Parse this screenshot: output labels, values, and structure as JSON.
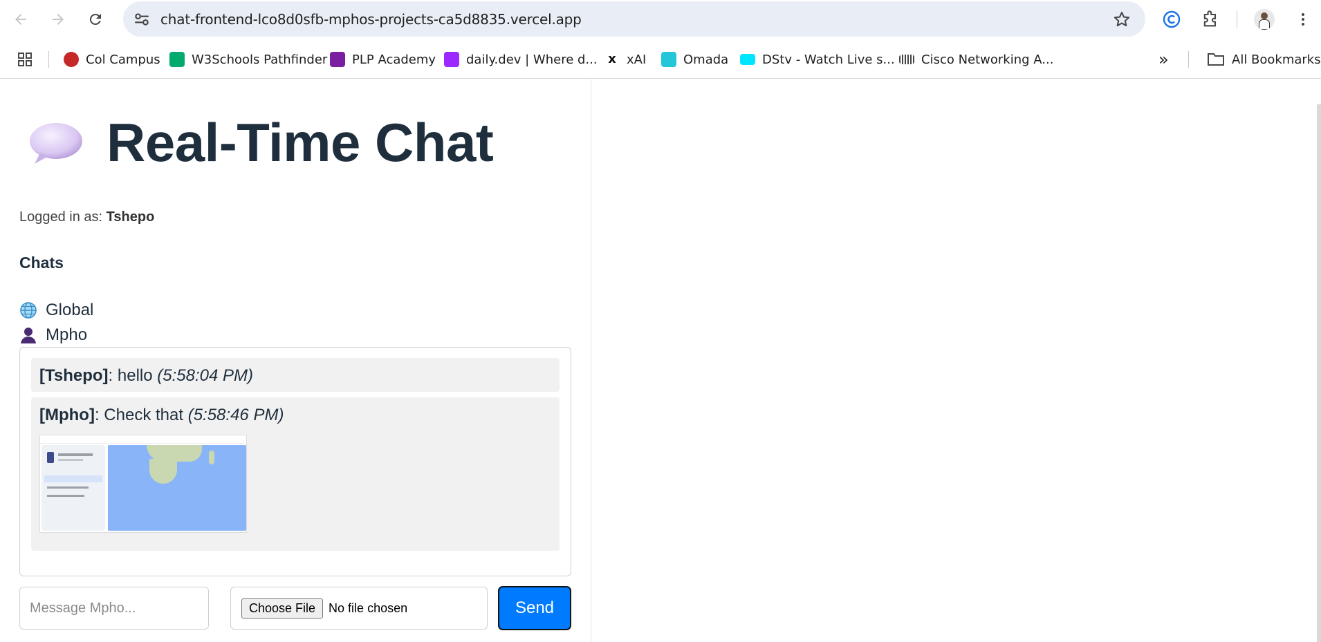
{
  "browser": {
    "url": "chat-frontend-lco8d0sfb-mphos-projects-ca5d8835.vercel.app",
    "bookmarks": [
      {
        "label": "Col Campus",
        "icon": "col-campus-icon",
        "color": "#c62828"
      },
      {
        "label": "W3Schools Pathfinder",
        "icon": "w3schools-icon",
        "color": "#04aa6d"
      },
      {
        "label": "PLP Academy",
        "icon": "plp-icon",
        "color": "#7b1fa2"
      },
      {
        "label": "daily.dev | Where d...",
        "icon": "dailydev-icon",
        "color": "#9c27ff"
      },
      {
        "label": "xAI",
        "icon": "xai-icon",
        "color": "#111111"
      },
      {
        "label": "Omada",
        "icon": "omada-icon",
        "color": "#26c6da"
      },
      {
        "label": "DStv - Watch Live s...",
        "icon": "dstv-icon",
        "color": "#00e5ff"
      },
      {
        "label": "Cisco Networking A...",
        "icon": "cisco-icon",
        "color": "#444444"
      }
    ],
    "all_bookmarks": "All Bookmarks",
    "overflow": "»"
  },
  "app": {
    "title": "Real-Time Chat",
    "logged_in_label": "Logged in as:",
    "username": "Tshepo",
    "chats_heading": "Chats",
    "chats": [
      {
        "label": "Global",
        "icon": "globe-icon"
      },
      {
        "label": "Mpho",
        "icon": "person-icon"
      }
    ],
    "messages": [
      {
        "sender": "[Tshepo]",
        "text": ": hello ",
        "time": "(5:58:04 PM)",
        "has_image": false
      },
      {
        "sender": "[Mpho]",
        "text": ": Check that ",
        "time": "(5:58:46 PM)",
        "has_image": true
      }
    ],
    "message_placeholder": "Message Mpho...",
    "choose_file_label": "Choose File",
    "no_file_label": "No file chosen",
    "send_label": "Send"
  }
}
